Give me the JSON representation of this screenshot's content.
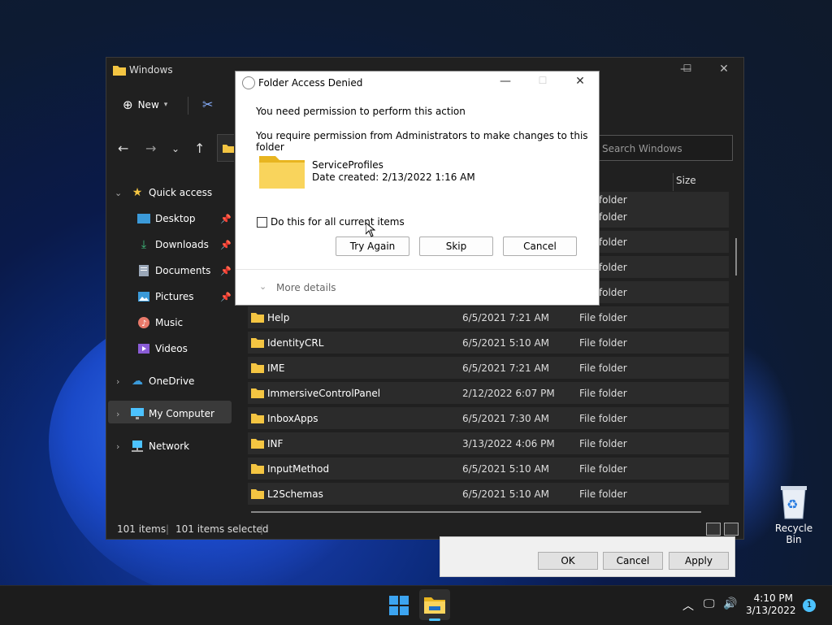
{
  "explorer": {
    "title": "Windows",
    "new_label": "New",
    "search_placeholder": "Search Windows",
    "size_header": "Size",
    "sidebar": {
      "quick_access": "Quick access",
      "desktop": "Desktop",
      "downloads": "Downloads",
      "documents": "Documents",
      "pictures": "Pictures",
      "music": "Music",
      "videos": "Videos",
      "onedrive": "OneDrive",
      "my_computer": "My Computer",
      "network": "Network"
    },
    "partial_rows": [
      {
        "type": "File folder"
      },
      {
        "type": "File folder"
      },
      {
        "type": "File folder"
      },
      {
        "type": "File folder"
      },
      {
        "type": "File folder"
      }
    ],
    "rows": [
      {
        "name": "Help",
        "date": "6/5/2021 7:21 AM",
        "type": "File folder"
      },
      {
        "name": "IdentityCRL",
        "date": "6/5/2021 5:10 AM",
        "type": "File folder"
      },
      {
        "name": "IME",
        "date": "6/5/2021 7:21 AM",
        "type": "File folder"
      },
      {
        "name": "ImmersiveControlPanel",
        "date": "2/12/2022 6:07 PM",
        "type": "File folder"
      },
      {
        "name": "InboxApps",
        "date": "6/5/2021 7:30 AM",
        "type": "File folder"
      },
      {
        "name": "INF",
        "date": "3/13/2022 4:06 PM",
        "type": "File folder"
      },
      {
        "name": "InputMethod",
        "date": "6/5/2021 5:10 AM",
        "type": "File folder"
      },
      {
        "name": "L2Schemas",
        "date": "6/5/2021 5:10 AM",
        "type": "File folder"
      }
    ],
    "status": {
      "items": "101 items",
      "selected": "101 items selected"
    }
  },
  "dialog": {
    "title": "Folder Access Denied",
    "line1": "You need permission to perform this action",
    "line2": "You require permission from Administrators to make changes to this folder",
    "folder_name": "ServiceProfiles",
    "date_created": "Date created: 2/13/2022 1:16 AM",
    "checkbox_label": "Do this for all current items",
    "try_again": "Try Again",
    "skip": "Skip",
    "cancel": "Cancel",
    "more_details": "More details"
  },
  "properties": {
    "ok": "OK",
    "cancel": "Cancel",
    "apply": "Apply"
  },
  "desktop": {
    "recycle_bin": "Recycle Bin"
  },
  "taskbar": {
    "time": "4:10 PM",
    "date": "3/13/2022",
    "notifications": "1"
  }
}
